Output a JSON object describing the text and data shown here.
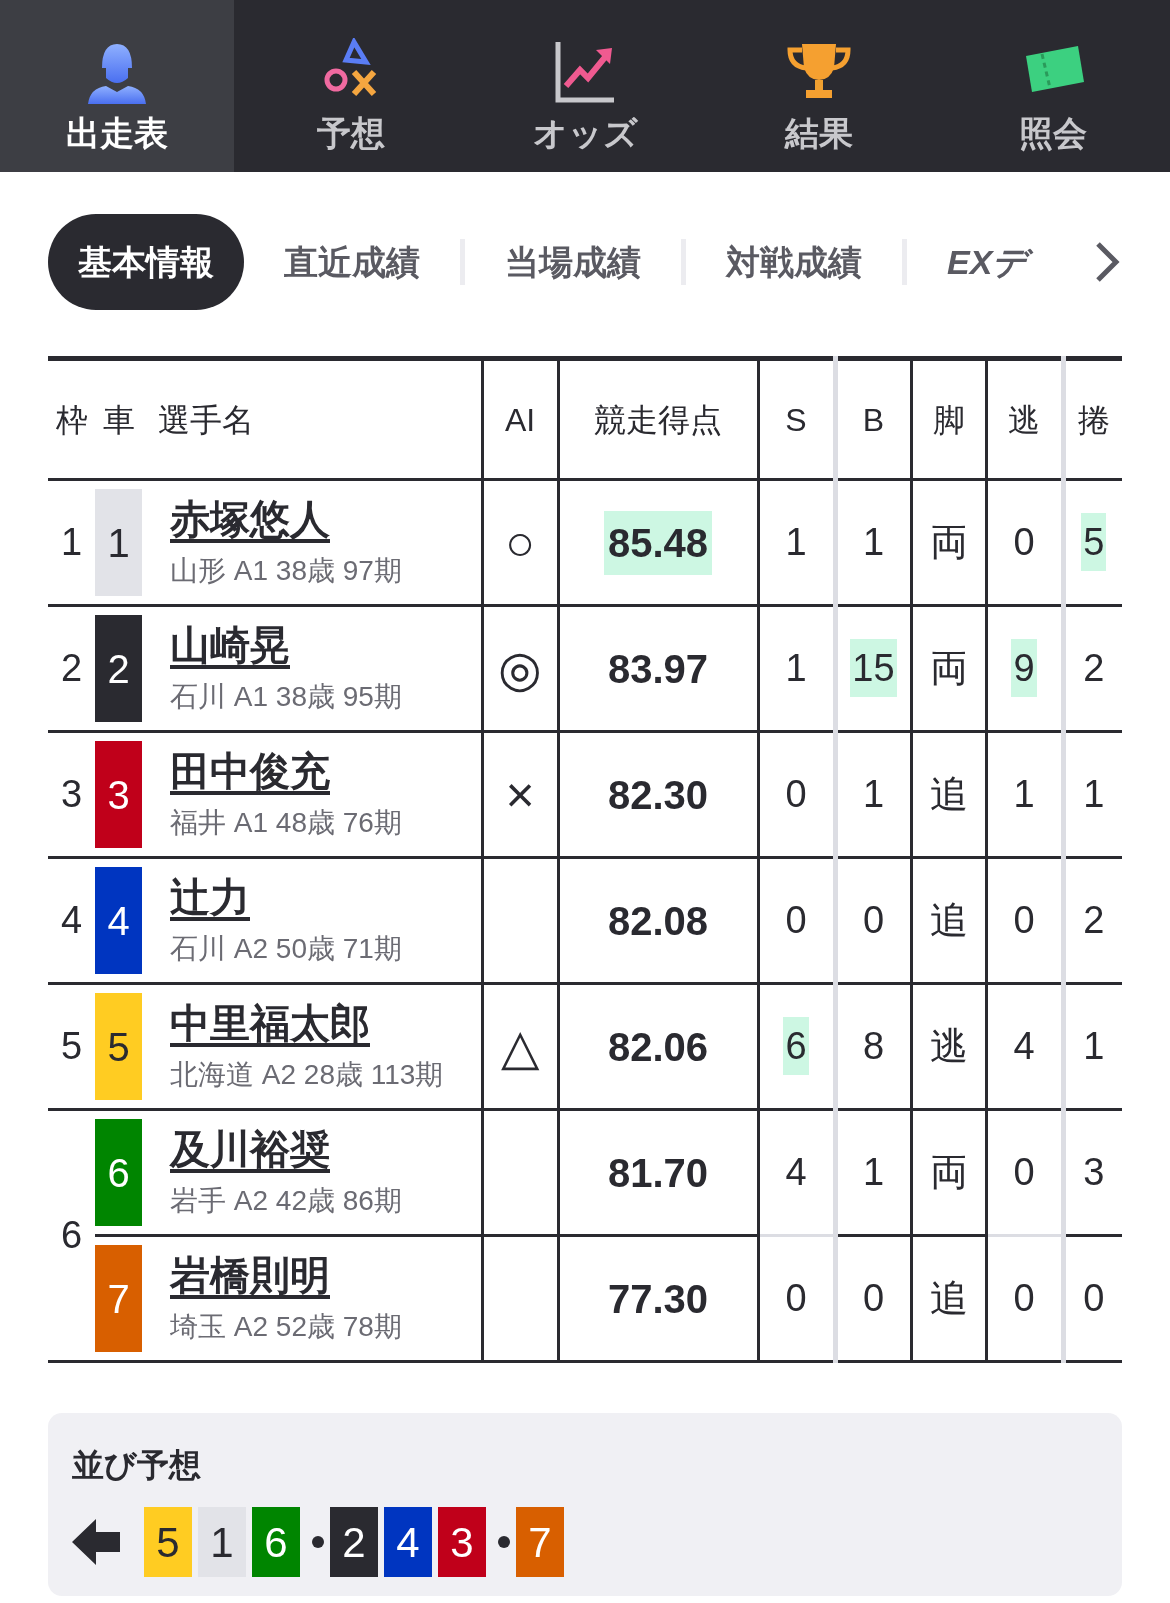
{
  "nav": [
    {
      "label": "出走表",
      "kind": "rider",
      "selected": true
    },
    {
      "label": "予想",
      "kind": "symbols",
      "selected": false
    },
    {
      "label": "オッズ",
      "kind": "chart",
      "selected": false
    },
    {
      "label": "結果",
      "kind": "trophy",
      "selected": false
    },
    {
      "label": "照会",
      "kind": "ticket",
      "selected": false
    }
  ],
  "tabs": [
    {
      "label": "基本情報",
      "selected": true
    },
    {
      "label": "直近成績",
      "selected": false
    },
    {
      "label": "当場成績",
      "selected": false
    },
    {
      "label": "対戦成績",
      "selected": false
    },
    {
      "label": "EXデ",
      "selected": false
    }
  ],
  "table": {
    "columns": [
      "枠",
      "車",
      "選手名",
      "AI",
      "競走得点",
      "S",
      "B",
      "脚",
      "逃",
      "捲"
    ],
    "frames": [
      {
        "number": "1",
        "riders": [
          {
            "car": "1",
            "color": "#e2e3e8",
            "name": "赤塚悠人",
            "info": "山形 A1 38歳 97期",
            "ai_mark": "○",
            "score": {
              "value": "85.48",
              "highlight": true
            },
            "stats": [
              {
                "value": "1",
                "highlight": false
              },
              {
                "value": "1",
                "highlight": false
              },
              {
                "value": "両",
                "highlight": false
              },
              {
                "value": "0",
                "highlight": false
              },
              {
                "value": "5",
                "highlight": true
              }
            ]
          }
        ]
      },
      {
        "number": "2",
        "riders": [
          {
            "car": "2",
            "color": "#2a2a30",
            "name": "山崎晃",
            "info": "石川 A1 38歳 95期",
            "ai_mark": "◎",
            "score": {
              "value": "83.97",
              "highlight": false
            },
            "stats": [
              {
                "value": "1",
                "highlight": false
              },
              {
                "value": "15",
                "highlight": true
              },
              {
                "value": "両",
                "highlight": false
              },
              {
                "value": "9",
                "highlight": true
              },
              {
                "value": "2",
                "highlight": false
              }
            ]
          }
        ]
      },
      {
        "number": "3",
        "riders": [
          {
            "car": "3",
            "color": "#c0001a",
            "name": "田中俊充",
            "info": "福井 A1 48歳 76期",
            "ai_mark": "×",
            "score": {
              "value": "82.30",
              "highlight": false
            },
            "stats": [
              {
                "value": "0",
                "highlight": false
              },
              {
                "value": "1",
                "highlight": false
              },
              {
                "value": "追",
                "highlight": false
              },
              {
                "value": "1",
                "highlight": false
              },
              {
                "value": "1",
                "highlight": false
              }
            ]
          }
        ]
      },
      {
        "number": "4",
        "riders": [
          {
            "car": "4",
            "color": "#0035c0",
            "name": "辻力",
            "info": "石川 A2 50歳 71期",
            "score": {
              "value": "82.08",
              "highlight": false
            },
            "stats": [
              {
                "value": "0",
                "highlight": false
              },
              {
                "value": "0",
                "highlight": false
              },
              {
                "value": "追",
                "highlight": false
              },
              {
                "value": "0",
                "highlight": false
              },
              {
                "value": "2",
                "highlight": false
              }
            ]
          }
        ]
      },
      {
        "number": "5",
        "riders": [
          {
            "car": "5",
            "color": "#ffcc22",
            "name": "中里福太郎",
            "info": "北海道 A2 28歳 113期",
            "ai_mark": "△",
            "score": {
              "value": "82.06",
              "highlight": false
            },
            "stats": [
              {
                "value": "6",
                "highlight": true
              },
              {
                "value": "8",
                "highlight": false
              },
              {
                "value": "逃",
                "highlight": false
              },
              {
                "value": "4",
                "highlight": false
              },
              {
                "value": "1",
                "highlight": false
              }
            ]
          }
        ]
      },
      {
        "number": "6",
        "riders": [
          {
            "car": "6",
            "color": "#008500",
            "name": "及川裕奨",
            "info": "岩手 A2 42歳 86期",
            "score": {
              "value": "81.70",
              "highlight": false
            },
            "stats": [
              {
                "value": "4",
                "highlight": false
              },
              {
                "value": "1",
                "highlight": false
              },
              {
                "value": "両",
                "highlight": false
              },
              {
                "value": "0",
                "highlight": false
              },
              {
                "value": "3",
                "highlight": false
              }
            ]
          },
          {
            "car": "7",
            "color": "#d85f00",
            "name": "岩橋則明",
            "info": "埼玉 A2 52歳 78期",
            "score": {
              "value": "77.30",
              "highlight": false
            },
            "stats": [
              {
                "value": "0",
                "highlight": false
              },
              {
                "value": "0",
                "highlight": false
              },
              {
                "value": "追",
                "highlight": false
              },
              {
                "value": "0",
                "highlight": false
              },
              {
                "value": "0",
                "highlight": false
              }
            ]
          }
        ]
      }
    ]
  },
  "line_prediction": {
    "title": "並び予想",
    "groups": [
      [
        {
          "car": "5",
          "color": "#ffcc22"
        },
        {
          "car": "1",
          "color": "#e2e3e8"
        },
        {
          "car": "6",
          "color": "#008500"
        }
      ],
      [
        {
          "car": "2",
          "color": "#2a2a30"
        },
        {
          "car": "4",
          "color": "#0035c0"
        },
        {
          "car": "3",
          "color": "#c0001a"
        }
      ],
      [
        {
          "car": "7",
          "color": "#d85f00"
        }
      ]
    ]
  }
}
